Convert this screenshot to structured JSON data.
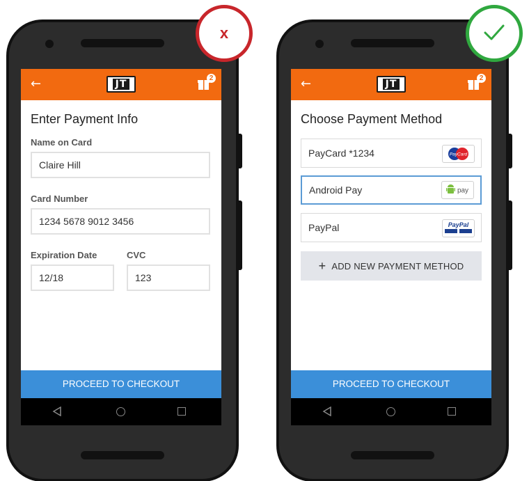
{
  "left_phone": {
    "verdict": "x",
    "appbar": {
      "back_icon": "arrow-left-icon",
      "logo": "JT",
      "cart_badge": "2"
    },
    "title": "Enter Payment Info",
    "fields": {
      "name_label": "Name on Card",
      "name_value": "Claire Hill",
      "card_label": "Card Number",
      "card_value": "1234 5678 9012 3456",
      "exp_label": "Expiration Date",
      "exp_value": "12/18",
      "cvc_label": "CVC",
      "cvc_value": "123"
    },
    "proceed_label": "PROCEED TO CHECKOUT"
  },
  "right_phone": {
    "verdict": "check",
    "appbar": {
      "back_icon": "arrow-left-icon",
      "logo": "JT",
      "cart_badge": "2"
    },
    "title": "Choose Payment Method",
    "methods": [
      {
        "label": "PayCard *1234",
        "logo_text": "PayCard",
        "selected": false
      },
      {
        "label": "Android Pay",
        "logo_text": "pay",
        "selected": true
      },
      {
        "label": "PayPal",
        "logo_text": "PayPal",
        "selected": false
      }
    ],
    "add_label": "ADD NEW PAYMENT METHOD",
    "proceed_label": "PROCEED TO CHECKOUT"
  },
  "colors": {
    "appbar": "#f26a10",
    "proceed": "#3b8fd9",
    "wrong": "#c8262b",
    "right": "#30a83f",
    "selected_border": "#5b9bd5"
  }
}
